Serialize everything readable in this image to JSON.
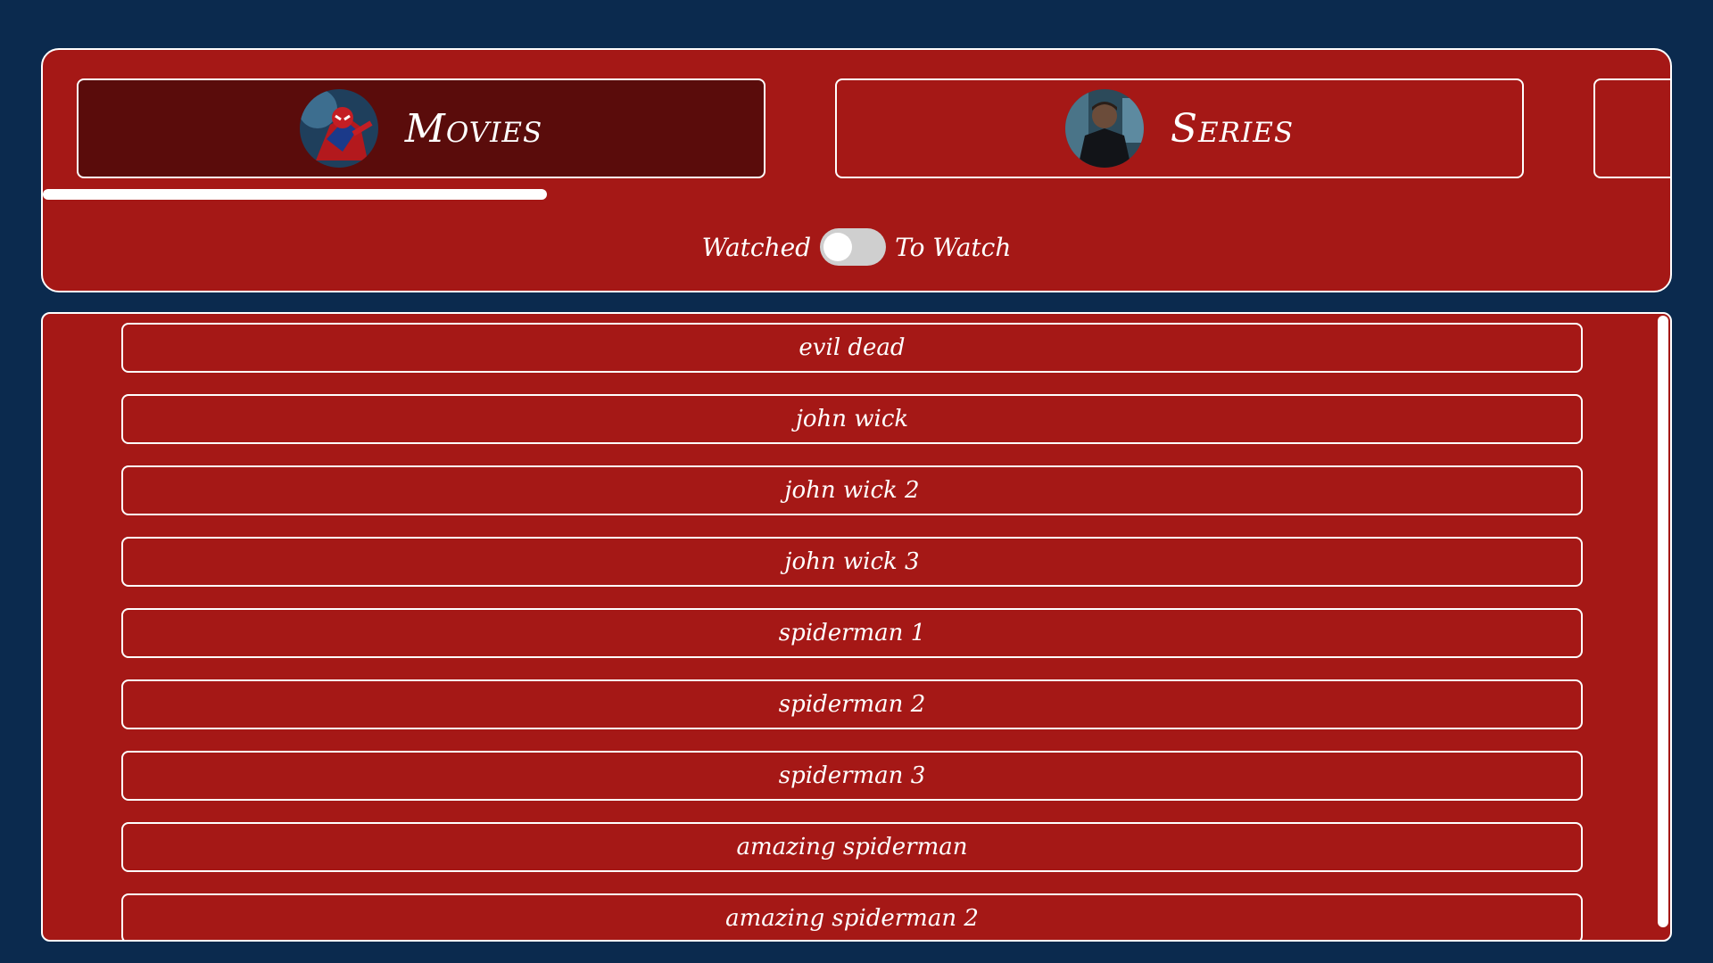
{
  "tabs": [
    {
      "label": "Movies",
      "active": true,
      "avatar_icon": "spiderman-avatar"
    },
    {
      "label": "Series",
      "active": false,
      "avatar_icon": "daredevil-avatar"
    }
  ],
  "tab_progress": 0.31,
  "toggle": {
    "left_label": "Watched",
    "right_label": "To Watch",
    "checked": false
  },
  "movies": [
    "evil dead",
    "john wick",
    "john wick 2",
    "john wick 3",
    "spiderman 1",
    "spiderman 2",
    "spiderman 3",
    "amazing spiderman",
    "amazing spiderman 2"
  ],
  "colors": {
    "background": "#0b2a4e",
    "panel": "#a51816",
    "active_tab": "#5a0c0b",
    "foreground": "#ffffff"
  }
}
